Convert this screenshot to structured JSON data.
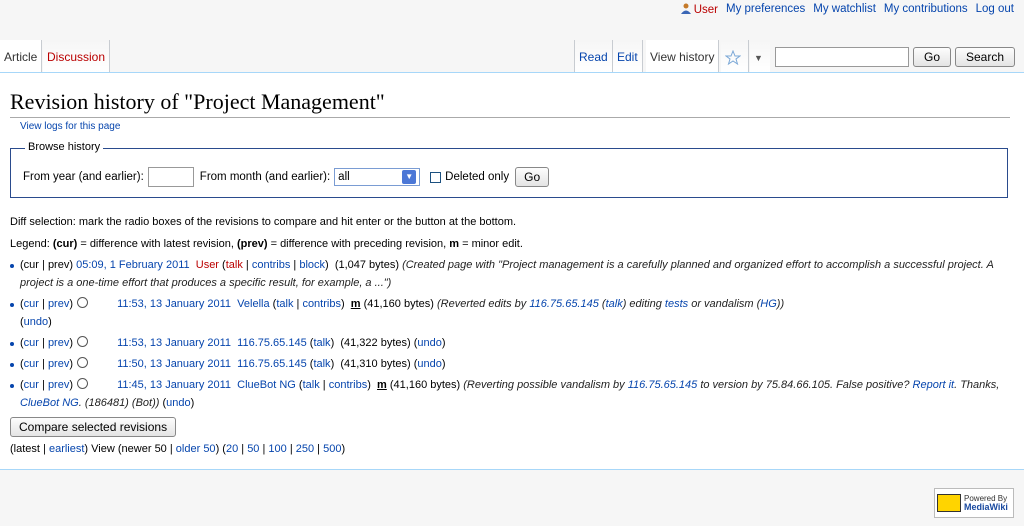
{
  "personal": {
    "user": "User",
    "preferences": "My preferences",
    "watchlist": "My watchlist",
    "contributions": "My contributions",
    "logout": "Log out"
  },
  "tabs": {
    "article": "Article",
    "discussion": "Discussion",
    "read": "Read",
    "edit": "Edit",
    "view_history": "View history"
  },
  "search": {
    "placeholder": "",
    "go": "Go",
    "search": "Search"
  },
  "page": {
    "title": "Revision history of \"Project Management\"",
    "view_logs": "View logs for this page"
  },
  "browse": {
    "legend": "Browse history",
    "year_label": "From year (and earlier):",
    "year_value": "",
    "month_label": "From month (and earlier):",
    "month_value": "all",
    "deleted_only": "Deleted only",
    "go": "Go"
  },
  "diff_info": "Diff selection: mark the radio boxes of the revisions to compare and hit enter or the button at the bottom.",
  "legend": {
    "prefix": "Legend: ",
    "cur": "(cur)",
    "cur_desc": " = difference with latest revision, ",
    "prev": "(prev)",
    "prev_desc": " = difference with preceding revision, ",
    "m": "m",
    "m_desc": " = minor edit."
  },
  "revisions": [
    {
      "date": "05:09, 1 February 2011",
      "user": "User",
      "size": "(1,047 bytes)",
      "comment": "(Created page with \"Project management is a carefully planned and organized effort to accomplish a successful project. A project is a one-time effort that produces a specific result, for example, a ...\")"
    },
    {
      "date": "11:53, 13 January 2011",
      "user": "Velella",
      "size": "(41,160 bytes)",
      "comment_a": "(Reverted edits by ",
      "ip": "116.75.65.145",
      "talk": "talk",
      "comment_b": ") editing ",
      "tests": "tests",
      "comment_c": " or vandalism (",
      "hg": "HG",
      "comment_d": "))",
      "undo": "undo"
    },
    {
      "date": "11:53, 13 January 2011",
      "user": "116.75.65.145",
      "size": "(41,322 bytes)",
      "undo": "undo"
    },
    {
      "date": "11:50, 13 January 2011",
      "user": "116.75.65.145",
      "size": "(41,310 bytes)",
      "undo": "undo"
    },
    {
      "date": "11:45, 13 January 2011",
      "user": "ClueBot NG",
      "size": "(41,160 bytes)",
      "comment_a": "(Reverting possible vandalism by ",
      "ip": "116.75.65.145",
      "comment_b": " to version by 75.84.66.105. False positive? ",
      "report": "Report it",
      "comment_c": ". Thanks, ",
      "cluebot": "ClueBot NG",
      "comment_d": ". (186481) (Bot))",
      "undo": "undo"
    }
  ],
  "common": {
    "cur": "cur",
    "prev": "prev",
    "talk": "talk",
    "contribs": "contribs",
    "block": "block",
    "undo": "undo",
    "m": "m"
  },
  "compare_button": "Compare selected revisions",
  "paging": {
    "latest": "latest",
    "earliest": "earliest",
    "view": "View",
    "newer": "newer 50",
    "older": "older 50",
    "n20": "20",
    "n50": "50",
    "n100": "100",
    "n250": "250",
    "n500": "500"
  },
  "footer": {
    "powered_by": "Powered By",
    "mediawiki": "MediaWiki"
  },
  "colors": {
    "link": "#0645ad",
    "redlink": "#ba0000",
    "border": "#a7d7f9"
  }
}
